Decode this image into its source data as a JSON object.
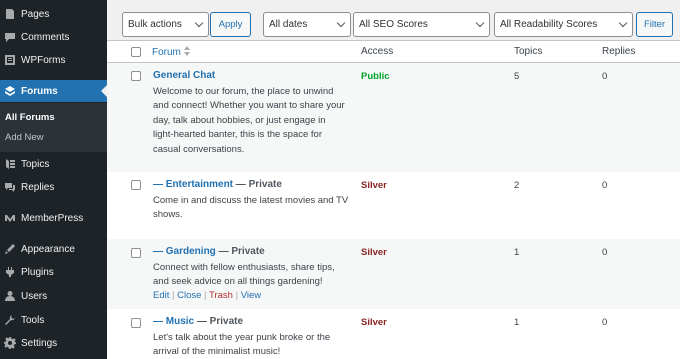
{
  "sidebar": {
    "items": [
      {
        "label": "Pages",
        "icon": "pages-icon"
      },
      {
        "label": "Comments",
        "icon": "comments-icon"
      },
      {
        "label": "WPForms",
        "icon": "wpforms-icon"
      },
      {
        "label": "Forums",
        "icon": "forums-icon"
      },
      {
        "label": "Topics",
        "icon": "topics-icon"
      },
      {
        "label": "Replies",
        "icon": "replies-icon"
      },
      {
        "label": "MemberPress",
        "icon": "memberpress-icon"
      },
      {
        "label": "Appearance",
        "icon": "appearance-icon"
      },
      {
        "label": "Plugins",
        "icon": "plugins-icon"
      },
      {
        "label": "Users",
        "icon": "users-icon"
      },
      {
        "label": "Tools",
        "icon": "tools-icon"
      },
      {
        "label": "Settings",
        "icon": "settings-icon"
      }
    ],
    "submenu": [
      "All Forums",
      "Add New"
    ],
    "active_color": "#2271b1"
  },
  "toolbar": {
    "bulk_actions": "Bulk actions",
    "apply": "Apply",
    "dates": "All dates",
    "seo": "All SEO Scores",
    "readability": "All Readability Scores",
    "filter": "Filter"
  },
  "table": {
    "headers": {
      "forum": "Forum",
      "access": "Access",
      "topics": "Topics",
      "replies": "Replies"
    },
    "rows": [
      {
        "title": "General Chat",
        "state": "",
        "desc": [
          "Welcome to our forum, the place to unwind",
          "and connect! Whether you want to share your",
          "day, talk about hobbies, or just engage in",
          "light-hearted banter, this is the space for",
          "casual conversations."
        ],
        "access": "Public",
        "topics": "5",
        "replies": "0"
      },
      {
        "title": "— Entertainment",
        "state": " — Private",
        "desc": [
          "Come in and discuss the latest movies and TV",
          "shows."
        ],
        "access": "Silver",
        "topics": "2",
        "replies": "0"
      },
      {
        "title": "— Gardening",
        "state": " — Private",
        "desc": [
          "Connect with fellow enthusiasts, share tips,",
          "and seek advice on all things gardening!"
        ],
        "access": "Silver",
        "topics": "1",
        "replies": "0",
        "actions": {
          "edit": "Edit",
          "close": "Close",
          "trash": "Trash",
          "view": "View"
        }
      },
      {
        "title": "— Music",
        "state": " — Private",
        "desc": [
          "Let's talk about the year punk broke or the",
          "arrival of the minimalist music!"
        ],
        "access": "Silver",
        "topics": "1",
        "replies": "0"
      }
    ],
    "access_colors": {
      "Public": "#00a32a",
      "Silver": "#8a2424"
    }
  }
}
